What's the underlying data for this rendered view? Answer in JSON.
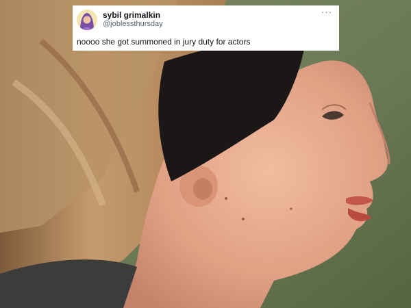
{
  "tweet": {
    "display_name": "sybil grimalkin",
    "handle": "@joblessthursday",
    "text": "noooo she got summoned in jury duty for actors",
    "more_icon": "more-horizontal-icon"
  },
  "photo": {
    "subject": "side-profile-woman-with-black-headband",
    "palette": {
      "background": "#6b7b5a",
      "hair": "#b48a5e",
      "headband": "#1c1717",
      "skin": "#e2a487",
      "lips": "#c4554a"
    }
  }
}
